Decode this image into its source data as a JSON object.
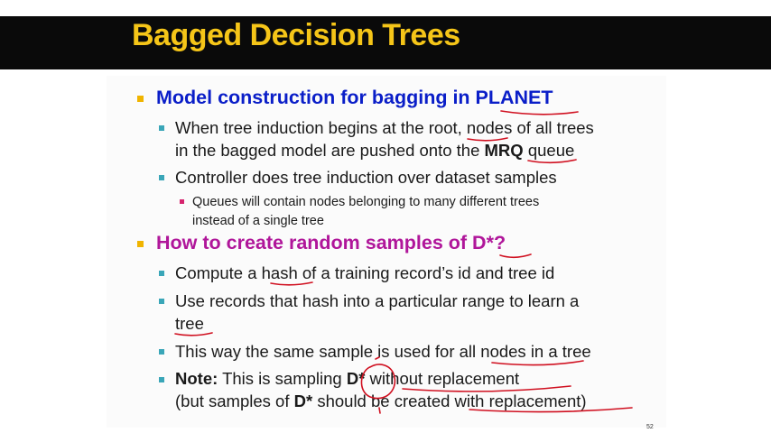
{
  "slide": {
    "title": "Bagged Decision Trees",
    "page_number": "52",
    "colors": {
      "title": "#f5c518",
      "topbar": "#0a0a0a",
      "heading1": "#0a1ec8",
      "heading2": "#b0169a",
      "bullet_l1": "#f0b400",
      "bullet_l2": "#3aa6b8",
      "bullet_l3": "#d6246e",
      "ink": "#d01020"
    }
  },
  "content": {
    "section1": {
      "heading": "Model construction for bagging in PLANET",
      "item1_line1": "When tree induction begins at the root, nodes of all trees",
      "item1_line2a": "in the bagged model are pushed onto the ",
      "item1_line2_bold": "MRQ",
      "item1_line2b": " queue",
      "item2": "Controller does tree induction over dataset samples",
      "sub1_line1": "Queues will contain nodes belonging to many different trees",
      "sub1_line2": "instead of a single tree"
    },
    "section2": {
      "heading": "How to create random samples of D*?",
      "item1": "Compute a hash of a training record’s id and tree id",
      "item2_line1": "Use records that hash into a particular range to learn a",
      "item2_line2": "tree",
      "item3": "This way the same sample is used for all nodes in a tree",
      "item4_bold": "Note:",
      "item4_a": " This is sampling ",
      "item4_bold2": "D*",
      "item4_b": " without replacement",
      "item4_line2a": "(but samples of ",
      "item4_line2_bold": "D*",
      "item4_line2b": " should be created with replacement)"
    }
  }
}
